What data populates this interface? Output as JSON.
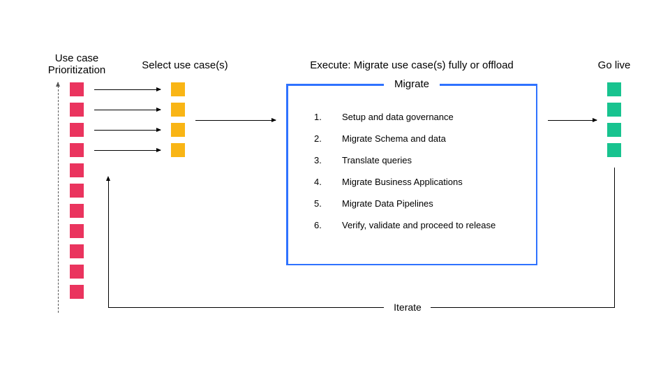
{
  "headings": {
    "prioritization_line1": "Use case",
    "prioritization_line2": "Prioritization",
    "select": "Select use case(s)",
    "execute": "Execute: Migrate use case(s) fully or offload",
    "golive": "Go live"
  },
  "migrate_box": {
    "label": "Migrate",
    "steps": [
      "Setup and data governance",
      "Migrate Schema and data",
      "Translate queries",
      "Migrate Business Applications",
      "Migrate Data Pipelines",
      "Verify, validate and proceed to release"
    ]
  },
  "iterate_label": "Iterate",
  "columns": {
    "prioritization_count": 11,
    "select_count": 4,
    "golive_count": 4
  },
  "colors": {
    "red": "#ea345e",
    "amber": "#f9b515",
    "green": "#18c38f",
    "box_border": "#2f72ff"
  }
}
